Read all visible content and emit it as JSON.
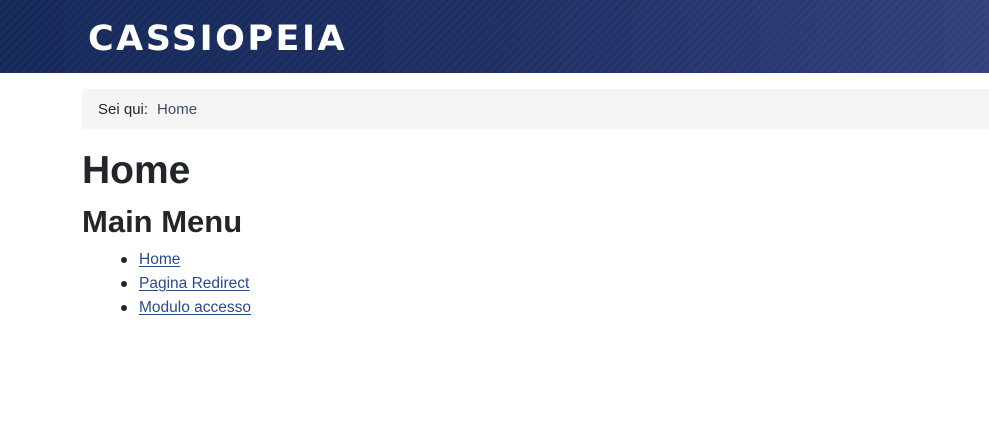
{
  "header": {
    "brand": "CASSIOPEIA"
  },
  "breadcrumb": {
    "label": "Sei qui:",
    "items": [
      "Home"
    ]
  },
  "main": {
    "title": "Home"
  },
  "menu_module": {
    "title": "Main Menu",
    "items": [
      {
        "label": "Home"
      },
      {
        "label": "Pagina Redirect"
      },
      {
        "label": "Modulo accesso"
      }
    ]
  },
  "colors": {
    "header_bg": "#1d2e63",
    "link": "#2a4b8d",
    "breadcrumb_bg": "#f5f5f5",
    "text": "#22262a"
  }
}
